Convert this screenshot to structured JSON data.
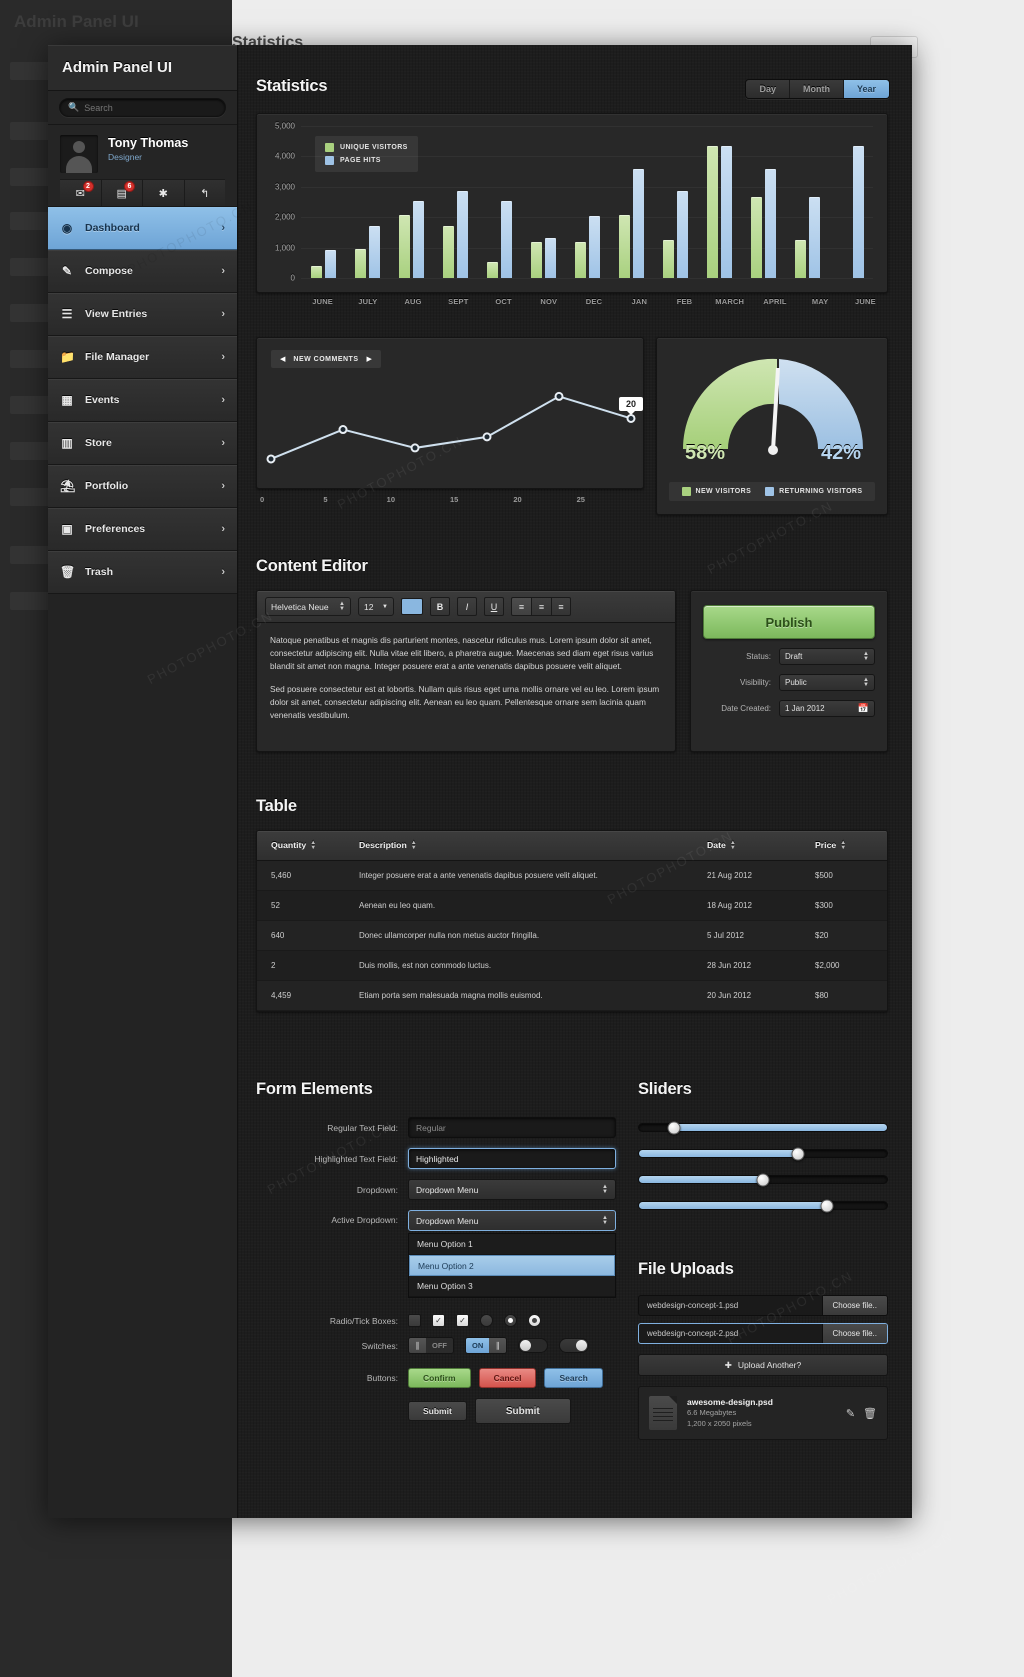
{
  "background": {
    "app_title": "Admin Panel UI",
    "section_title": "Statistics"
  },
  "sidebar": {
    "title": "Admin Panel UI",
    "search_placeholder": "Search",
    "profile": {
      "name": "Tony Thomas",
      "role": "Designer"
    },
    "profile_buttons": [
      {
        "icon": "inbox-icon",
        "glyph": "✉",
        "badge": "2"
      },
      {
        "icon": "notes-icon",
        "glyph": "▤",
        "badge": "6"
      },
      {
        "icon": "tools-icon",
        "glyph": "✱",
        "badge": ""
      },
      {
        "icon": "logout-icon",
        "glyph": "↰",
        "badge": ""
      }
    ],
    "items": [
      {
        "label": "Dashboard",
        "icon": "dashboard-icon",
        "glyph": "◉",
        "active": true
      },
      {
        "label": "Compose",
        "icon": "compose-icon",
        "glyph": "✎",
        "active": false
      },
      {
        "label": "View Entries",
        "icon": "list-icon",
        "glyph": "☰",
        "active": false
      },
      {
        "label": "File Manager",
        "icon": "folder-icon",
        "glyph": "▃",
        "active": false
      },
      {
        "label": "Events",
        "icon": "calendar-icon",
        "glyph": "▦",
        "active": false
      },
      {
        "label": "Store",
        "icon": "store-icon",
        "glyph": "▥",
        "active": false
      },
      {
        "label": "Portfolio",
        "icon": "portfolio-icon",
        "glyph": "◱",
        "active": false
      },
      {
        "label": "Preferences",
        "icon": "preferences-icon",
        "glyph": "▣",
        "active": false
      },
      {
        "label": "Trash",
        "icon": "trash-icon",
        "glyph": "Ὕ1",
        "active": false
      }
    ],
    "arrow_glyph": "›"
  },
  "statistics": {
    "title": "Statistics",
    "range_tabs": [
      {
        "label": "Day",
        "selected": false
      },
      {
        "label": "Month",
        "selected": false
      },
      {
        "label": "Year",
        "selected": true
      }
    ]
  },
  "chart_data": [
    {
      "type": "bar",
      "title": "Statistics",
      "xlabel": "",
      "ylabel": "",
      "ylim": [
        0,
        5000
      ],
      "yticks": [
        "5,000",
        "4,000",
        "3,000",
        "2,000",
        "1,000",
        "0"
      ],
      "grid": true,
      "legend_position": "top-left",
      "categories": [
        "JUNE",
        "JULY",
        "AUG",
        "SEPT",
        "OCT",
        "NOV",
        "DEC",
        "JAN",
        "FEB",
        "MARCH",
        "APRIL",
        "MAY",
        "JUNE"
      ],
      "series": [
        {
          "name": "UNIQUE VISITORS",
          "color": "#a9d17f",
          "values": [
            400,
            950,
            2080,
            1720,
            540,
            1170,
            1180,
            2080,
            1250,
            4350,
            2650,
            1250,
            0
          ]
        },
        {
          "name": "PAGE HITS",
          "color": "#9fc3e6",
          "values": [
            930,
            1720,
            2520,
            2850,
            2520,
            1330,
            2050,
            3600,
            2850,
            4350,
            3600,
            2650,
            4350
          ]
        }
      ]
    },
    {
      "type": "line",
      "title": "NEW COMMENTS",
      "xlabel": "",
      "ylabel": "",
      "xticks": [
        "0",
        "5",
        "10",
        "15",
        "20",
        "25"
      ],
      "xlim": [
        0,
        25
      ],
      "ylim": [
        0,
        25
      ],
      "grid": false,
      "line_color": "#cfe0ee",
      "annotation": {
        "label": "20",
        "at_index": 5
      },
      "x": [
        0,
        5,
        10,
        15,
        20,
        25
      ],
      "values": [
        3,
        11,
        6,
        9,
        20,
        14
      ]
    },
    {
      "type": "pie",
      "title": "",
      "labels": [
        "NEW VISITORS",
        "RETURNING VISITORS"
      ],
      "values": [
        58,
        42
      ],
      "display_values": [
        "58%",
        "42%"
      ],
      "colors": [
        "#a9d17f",
        "#9fc3e6"
      ],
      "legend_position": "bottom"
    }
  ],
  "editor": {
    "title": "Content Editor",
    "toolbar": {
      "font_family": "Helvetica Neue",
      "font_size": "12",
      "color_swatch": "#8ab7e0",
      "bold": "B",
      "italic": "I",
      "underline": "U",
      "align_left": "≡",
      "align_center": "≡",
      "align_right": "≡"
    },
    "paragraphs": [
      "Natoque penatibus et magnis dis parturient montes, nascetur ridiculus mus. Lorem ipsum dolor sit amet, consectetur adipiscing elit. Nulla vitae elit libero, a pharetra augue. Maecenas sed diam eget risus varius blandit sit amet non magna. Integer posuere erat a ante venenatis dapibus posuere velit aliquet.",
      "Sed posuere consectetur est at lobortis. Nullam quis risus eget urna mollis ornare vel eu leo. Lorem ipsum dolor sit amet, consectetur adipiscing elit. Aenean eu leo quam. Pellentesque ornare sem lacinia quam venenatis vestibulum."
    ],
    "publish": {
      "button_label": "Publish",
      "fields": [
        {
          "label": "Status:",
          "value": "Draft",
          "type": "select"
        },
        {
          "label": "Visibility:",
          "value": "Public",
          "type": "select"
        },
        {
          "label": "Date Created:",
          "value": "1 Jan 2012",
          "type": "date"
        }
      ]
    }
  },
  "table": {
    "title": "Table",
    "columns": [
      "Quantity",
      "Description",
      "Date",
      "Price"
    ],
    "rows": [
      [
        "5,460",
        "Integer posuere erat a ante venenatis dapibus posuere velit aliquet.",
        "21 Aug 2012",
        "$500"
      ],
      [
        "52",
        "Aenean eu leo quam.",
        "18 Aug 2012",
        "$300"
      ],
      [
        "640",
        "Donec ullamcorper nulla non metus auctor fringilla.",
        "5 Jul 2012",
        "$20"
      ],
      [
        "2",
        "Duis mollis, est non commodo luctus.",
        "28 Jun 2012",
        "$2,000"
      ],
      [
        "4,459",
        "Etiam porta sem malesuada magna mollis euismod.",
        "20 Jun 2012",
        "$80"
      ]
    ]
  },
  "form": {
    "title": "Form Elements",
    "fields": [
      {
        "label": "Regular Text Field:",
        "value": "Regular",
        "highlighted": false
      },
      {
        "label": "Highlighted Text Field:",
        "value": "Highlighted",
        "highlighted": true
      }
    ],
    "dropdown": {
      "label": "Dropdown:",
      "value": "Dropdown Menu"
    },
    "active_dropdown": {
      "label": "Active Dropdown:",
      "value": "Dropdown Menu",
      "options": [
        "Menu Option 1",
        "Menu Option 2",
        "Menu Option 3"
      ],
      "selected_index": 1
    },
    "radio_label": "Radio/Tick Boxes:",
    "switch_label": "Switches:",
    "switch_off_text": "OFF",
    "switch_on_text": "ON",
    "buttons_label": "Buttons:",
    "buttons": [
      {
        "label": "Confirm",
        "style": "green"
      },
      {
        "label": "Cancel",
        "style": "red"
      },
      {
        "label": "Search",
        "style": "blue"
      }
    ],
    "submit_small": "Submit",
    "submit_large": "Submit"
  },
  "sliders": {
    "title": "Sliders",
    "values": [
      14,
      64,
      50,
      76
    ]
  },
  "uploads": {
    "title": "File Uploads",
    "rows": [
      {
        "name": "webdesign-concept-1.psd",
        "button": "Choose file..",
        "highlighted": false
      },
      {
        "name": "webdesign-concept-2.psd",
        "button": "Choose file..",
        "highlighted": true
      }
    ],
    "add_another": "Upload Another?",
    "add_icon": "plus-icon",
    "file": {
      "name": "awesome-design.psd",
      "size": "6.6 Megabytes",
      "dimensions": "1,200 x 2050 pixels",
      "edit_icon": "edit-icon",
      "delete_icon": "trash-icon"
    }
  }
}
